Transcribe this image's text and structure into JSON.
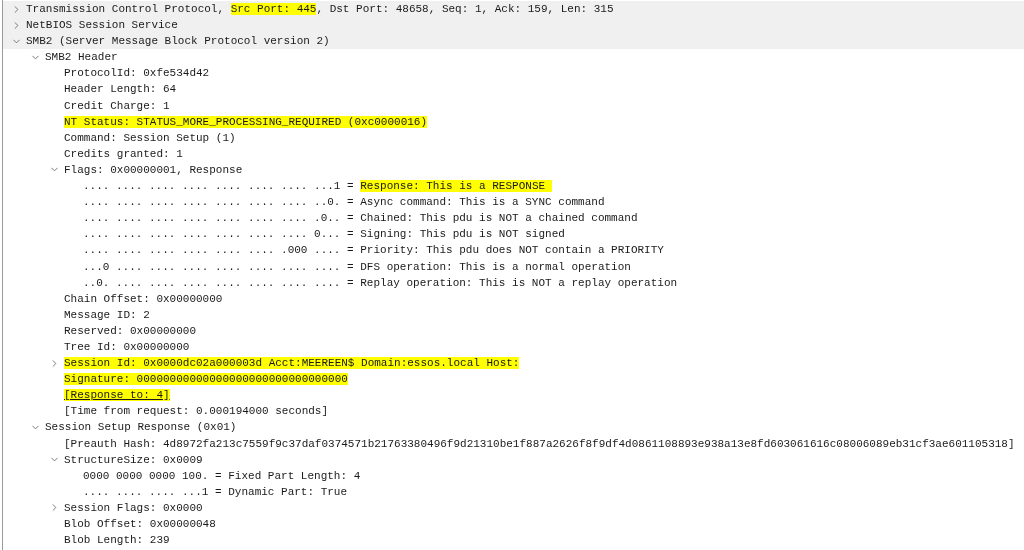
{
  "tree": [
    {
      "segments": [
        {
          "text": "Transmission Control Protocol, ",
          "highlighted": false
        },
        {
          "text": "Src Port: 445",
          "highlighted": true
        },
        {
          "text": ", Dst Port: 48658, Seq: 1, Ack: 159, Len: 315",
          "highlighted": false
        }
      ],
      "expanded": false
    },
    {
      "segments": [
        {
          "text": "NetBIOS Session Service",
          "highlighted": false
        }
      ],
      "expanded": false
    },
    {
      "segments": [
        {
          "text": "SMB2 (Server Message Block Protocol version 2)",
          "highlighted": false
        }
      ],
      "expanded": true,
      "children": [
        {
          "segments": [
            {
              "text": "SMB2 Header",
              "highlighted": false
            }
          ],
          "expanded": true,
          "children": [
            {
              "segments": [
                {
                  "text": "ProtocolId: 0xfe534d42",
                  "highlighted": false
                }
              ]
            },
            {
              "segments": [
                {
                  "text": "Header Length: 64",
                  "highlighted": false
                }
              ]
            },
            {
              "segments": [
                {
                  "text": "Credit Charge: 1",
                  "highlighted": false
                }
              ]
            },
            {
              "segments": [
                {
                  "text": "NT Status: STATUS_MORE_PROCESSING_REQUIRED (0xc0000016)",
                  "highlighted": true
                }
              ]
            },
            {
              "segments": [
                {
                  "text": "Command: Session Setup (1)",
                  "highlighted": false
                }
              ]
            },
            {
              "segments": [
                {
                  "text": "Credits granted: 1",
                  "highlighted": false
                }
              ]
            },
            {
              "segments": [
                {
                  "text": "Flags: 0x00000001, Response",
                  "highlighted": false
                }
              ],
              "expanded": true,
              "children": [
                {
                  "segments": [
                    {
                      "text": ".... .... .... .... .... .... .... ...1 = ",
                      "highlighted": false
                    },
                    {
                      "text": "Response: This is a RESPONSE ",
                      "highlighted": true
                    }
                  ]
                },
                {
                  "segments": [
                    {
                      "text": ".... .... .... .... .... .... .... ..0. = Async command: This is a SYNC command",
                      "highlighted": false
                    }
                  ]
                },
                {
                  "segments": [
                    {
                      "text": ".... .... .... .... .... .... .... .0.. = Chained: This pdu is NOT a chained command",
                      "highlighted": false
                    }
                  ]
                },
                {
                  "segments": [
                    {
                      "text": ".... .... .... .... .... .... .... 0... = Signing: This pdu is NOT signed",
                      "highlighted": false
                    }
                  ]
                },
                {
                  "segments": [
                    {
                      "text": ".... .... .... .... .... .... .000 .... = Priority: This pdu does NOT contain a PRIORITY",
                      "highlighted": false
                    }
                  ]
                },
                {
                  "segments": [
                    {
                      "text": "...0 .... .... .... .... .... .... .... = DFS operation: This is a normal operation",
                      "highlighted": false
                    }
                  ]
                },
                {
                  "segments": [
                    {
                      "text": "..0. .... .... .... .... .... .... .... = Replay operation: This is NOT a replay operation",
                      "highlighted": false
                    }
                  ]
                }
              ]
            },
            {
              "segments": [
                {
                  "text": "Chain Offset: 0x00000000",
                  "highlighted": false
                }
              ]
            },
            {
              "segments": [
                {
                  "text": "Message ID: 2",
                  "highlighted": false
                }
              ]
            },
            {
              "segments": [
                {
                  "text": "Reserved: 0x00000000",
                  "highlighted": false
                }
              ]
            },
            {
              "segments": [
                {
                  "text": "Tree Id: 0x00000000",
                  "highlighted": false
                }
              ]
            },
            {
              "segments": [
                {
                  "text": "Session Id: 0x0000dc02a000003d Acct:MEEREEN$ Domain:essos.local Host:",
                  "highlighted": true
                }
              ],
              "expanded": false
            },
            {
              "segments": [
                {
                  "text": "Signature: 00000000000000000000000000000000",
                  "highlighted": true
                }
              ]
            },
            {
              "segments": [
                {
                  "text": "[Response to: 4]",
                  "highlighted": true
                }
              ],
              "link": true
            },
            {
              "segments": [
                {
                  "text": "[Time from request: 0.000194000 seconds]",
                  "highlighted": false
                }
              ]
            }
          ]
        },
        {
          "segments": [
            {
              "text": "Session Setup Response (0x01)",
              "highlighted": false
            }
          ],
          "expanded": true,
          "children": [
            {
              "segments": [
                {
                  "text": "[Preauth Hash: 4d8972fa213c7559f9c37daf0374571b21763380496f9d21310be1f887a2626f8f9df4d0861108893e938a13e8fd603061616c08006089eb31cf3ae601105318]",
                  "highlighted": false
                }
              ]
            },
            {
              "segments": [
                {
                  "text": "StructureSize: 0x0009",
                  "highlighted": false
                }
              ],
              "expanded": true,
              "children": [
                {
                  "segments": [
                    {
                      "text": "0000 0000 0000 100. = Fixed Part Length: 4",
                      "highlighted": false
                    }
                  ]
                },
                {
                  "segments": [
                    {
                      "text": ".... .... .... ...1 = Dynamic Part: True",
                      "highlighted": false
                    }
                  ]
                }
              ]
            },
            {
              "segments": [
                {
                  "text": "Session Flags: 0x0000",
                  "highlighted": false
                }
              ],
              "expanded": false
            },
            {
              "segments": [
                {
                  "text": "Blob Offset: 0x00000048",
                  "highlighted": false
                }
              ]
            },
            {
              "segments": [
                {
                  "text": "Blob Length: 239",
                  "highlighted": false
                }
              ]
            }
          ]
        }
      ]
    }
  ]
}
